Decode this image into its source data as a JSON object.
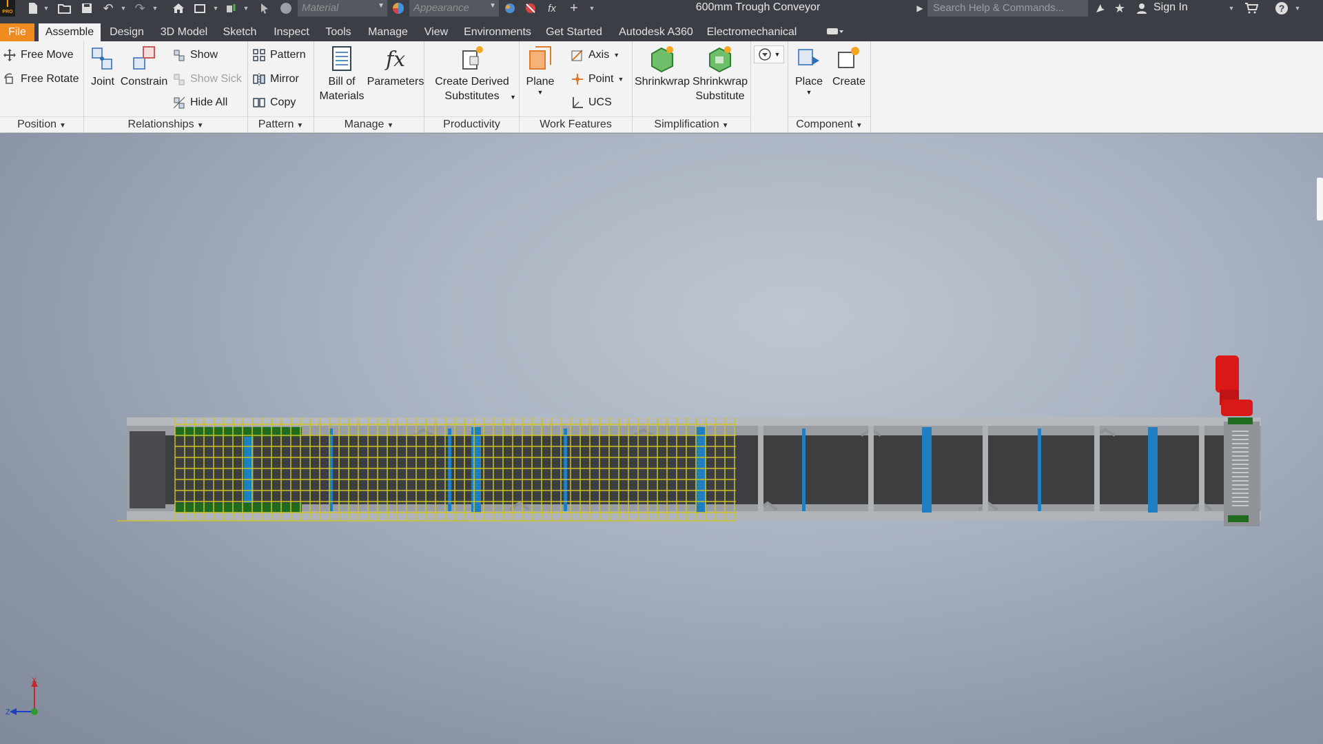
{
  "app": {
    "logo_text": "I",
    "logo_sub": "PRO"
  },
  "quick_access": {
    "material_placeholder": "Material",
    "appearance_placeholder": "Appearance",
    "fx_label": "fx"
  },
  "title": "600mm Trough Conveyor",
  "search": {
    "placeholder": "Search Help & Commands..."
  },
  "signin_label": "Sign In",
  "tabs": [
    {
      "label": "File"
    },
    {
      "label": "Assemble"
    },
    {
      "label": "Design"
    },
    {
      "label": "3D Model"
    },
    {
      "label": "Sketch"
    },
    {
      "label": "Inspect"
    },
    {
      "label": "Tools"
    },
    {
      "label": "Manage"
    },
    {
      "label": "View"
    },
    {
      "label": "Environments"
    },
    {
      "label": "Get Started"
    },
    {
      "label": "Autodesk A360"
    },
    {
      "label": "Electromechanical"
    }
  ],
  "ribbon": {
    "position": {
      "title": "Position",
      "free_move": "Free Move",
      "free_rotate": "Free Rotate"
    },
    "relationships": {
      "title": "Relationships",
      "joint": "Joint",
      "constrain": "Constrain",
      "show": "Show",
      "show_sick": "Show Sick",
      "hide_all": "Hide All"
    },
    "pattern": {
      "title": "Pattern",
      "pattern": "Pattern",
      "mirror": "Mirror",
      "copy": "Copy"
    },
    "manage": {
      "title": "Manage",
      "bom_line1": "Bill of",
      "bom_line2": "Materials",
      "parameters": "Parameters"
    },
    "productivity": {
      "title": "Productivity",
      "derived_line1": "Create Derived",
      "derived_line2": "Substitutes"
    },
    "work_features": {
      "title": "Work Features",
      "plane": "Plane",
      "axis": "Axis",
      "point": "Point",
      "ucs": "UCS"
    },
    "simplification": {
      "title": "Simplification",
      "shrinkwrap": "Shrinkwrap",
      "shrinkwrap_sub_line1": "Shrinkwrap",
      "shrinkwrap_sub_line2": "Substitute"
    },
    "component": {
      "title": "Component",
      "place": "Place",
      "create": "Create"
    }
  },
  "triad": {
    "x": "X",
    "z": "Z"
  },
  "colors": {
    "file_tab": "#f08c1f",
    "frame": "#9a9ea3",
    "belt": "#3d3e40",
    "roller": "#1f7fc0",
    "grid": "#c8c32a",
    "motor": "#d91818",
    "green_part": "#1f6b1f"
  }
}
